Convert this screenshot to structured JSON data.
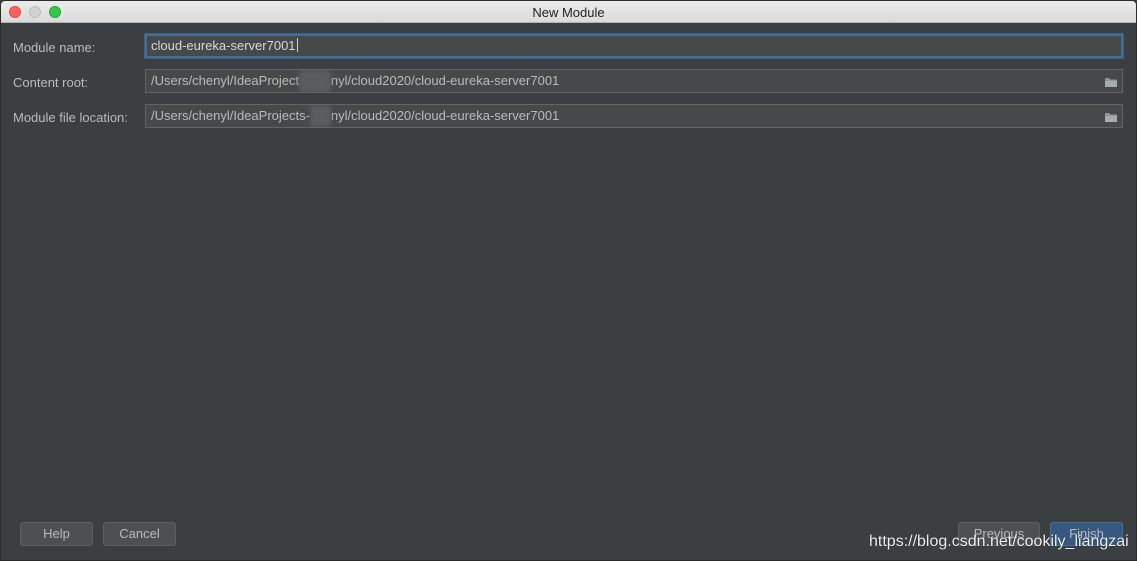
{
  "window": {
    "title": "New Module"
  },
  "form": {
    "module_name": {
      "label": "Module name:",
      "value": "cloud-eureka-server7001"
    },
    "content_root": {
      "label": "Content root:",
      "value_prefix": "/Users/chenyl/IdeaProject",
      "value_hidden": "s-che",
      "value_suffix": "nyl/cloud2020/cloud-eureka-server7001"
    },
    "module_file_location": {
      "label": "Module file location:",
      "value_prefix": "/Users/chenyl/IdeaProjects-",
      "value_hidden": "che",
      "value_suffix": "nyl/cloud2020/cloud-eureka-server7001"
    }
  },
  "buttons": {
    "help": "Help",
    "cancel": "Cancel",
    "previous": "Previous",
    "finish": "Finish"
  },
  "watermark": "https://blog.csdn.net/cookily_liangzai",
  "icons": {
    "folder": "folder-icon"
  },
  "colors": {
    "background": "#3c3f41",
    "field_background": "#45494a",
    "focus_border": "#466d94",
    "default_button": "#365880",
    "close": "#fc605c",
    "maximize": "#34c84a"
  }
}
